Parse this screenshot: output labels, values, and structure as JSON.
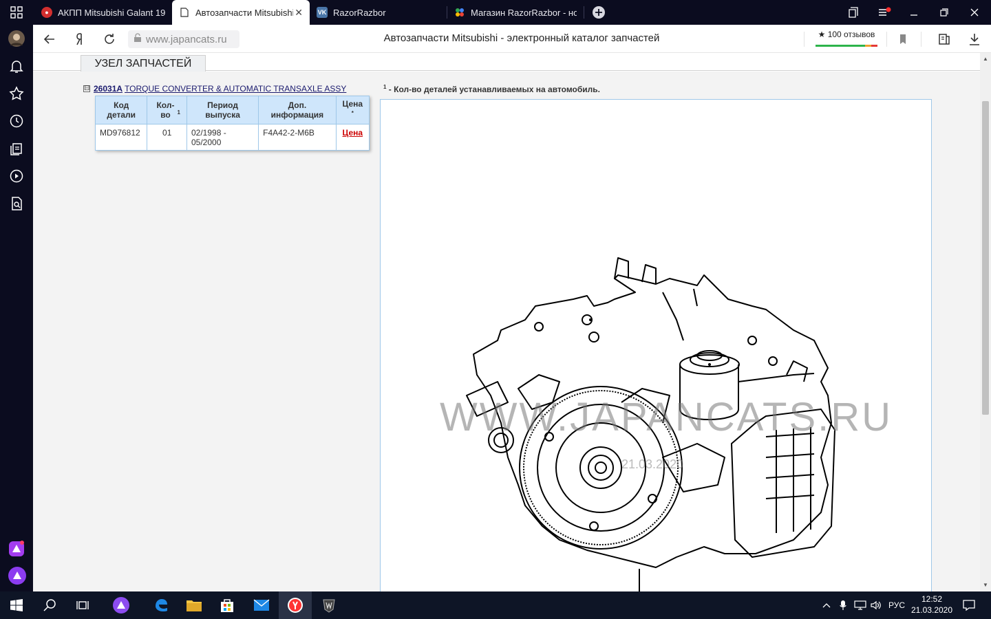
{
  "browser": {
    "tabs": [
      {
        "title": "АКПП Mitsubishi Galant 19",
        "favicon": "autoparts-favicon",
        "active": false
      },
      {
        "title": "Автозапчасти Mitsubishi",
        "favicon": "page-icon",
        "active": true
      },
      {
        "title": "RazorRazbor",
        "favicon": "vk-icon",
        "active": false
      },
      {
        "title": "Магазин RazorRazbor - но",
        "favicon": "shop-icon",
        "active": false
      }
    ],
    "address": "www.japancats.ru",
    "page_title": "Автозапчасти Mitsubishi - электронный каталог запчастей",
    "reviews": "★ 100 отзывов"
  },
  "catalog": {
    "section_title": "УЗЕЛ ЗАПЧАСТЕЙ",
    "collapse_symbol": "⊟",
    "assembly_code": "26031A",
    "assembly_name": "TORQUE CONVERTER & AUTOMATIC TRANSAXLE ASSY",
    "footnote_marker": "1",
    "footnote": " - Кол-во деталей устанавливаемых на автомобиль.",
    "table": {
      "headers": [
        "Код детали",
        "Кол-во",
        "Период выпуска",
        "Доп. информация",
        "Цена"
      ],
      "qty_sup": "1",
      "price_sup": "*",
      "rows": [
        {
          "code": "MD976812",
          "qty": "01",
          "period": "02/1998 - 05/2000",
          "info": "F4A42-2-M6B",
          "price": "Цена"
        }
      ]
    },
    "watermark": "WWW.JAPANCATS.RU",
    "watermark_date": "21.03.2020"
  },
  "taskbar": {
    "lang": "РУС",
    "time": "12:52",
    "date": "21.03.2020"
  },
  "colors": {
    "dark": "#0b0c1f",
    "table_header": "#cfe6fb",
    "table_border": "#9ec7e8",
    "price_link": "#cc0000",
    "notify_dot": "#ff2d2d"
  }
}
